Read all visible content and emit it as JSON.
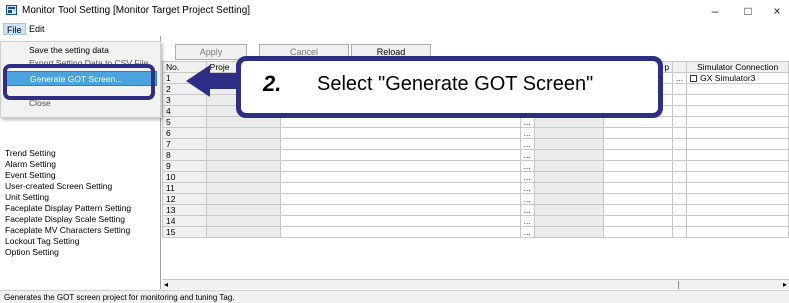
{
  "window": {
    "title": "Monitor Tool Setting [Monitor Target Project Setting]",
    "minimize": "–",
    "maximize": "□",
    "close": "×"
  },
  "menubar": {
    "file": "File",
    "edit": "Edit"
  },
  "file_menu": {
    "items": [
      "Save the setting data",
      "Export Setting Data to CSV File",
      "Generate GOT Screen...",
      "Close"
    ],
    "highlighted": "Generate GOT Screen..."
  },
  "sidebar": {
    "items": [
      "Trend Setting",
      "Alarm Setting",
      "Event Setting",
      "User-created Screen Setting",
      "Unit Setting",
      "Faceplate Display Pattern Setting",
      "Faceplate Display Scale Setting",
      "Faceplate MV Characters Setting",
      "Lockout Tag Setting",
      "Option Setting"
    ]
  },
  "toolbar": {
    "apply": "Apply",
    "cancel": "Cancel",
    "reload": "Reload"
  },
  "grid": {
    "headers": {
      "no": "No.",
      "project": "Proje",
      "ip": "p",
      "simulator": "Simulator Connection"
    },
    "rows": [
      "1",
      "2",
      "3",
      "4",
      "5",
      "6",
      "7",
      "8",
      "9",
      "10",
      "11",
      "12",
      "13",
      "14",
      "15"
    ],
    "row1_simulator": "GX Simulator3",
    "ellipsis": "..."
  },
  "scroll": {
    "left": "◂",
    "right": "▸"
  },
  "callout": {
    "step": "2.",
    "text": "Select \"Generate GOT Screen\""
  },
  "status": "Generates the GOT screen project for monitoring and tuning Tag.",
  "colors": {
    "callout_border": "#2d2f86",
    "highlight": "#4aa3df"
  }
}
